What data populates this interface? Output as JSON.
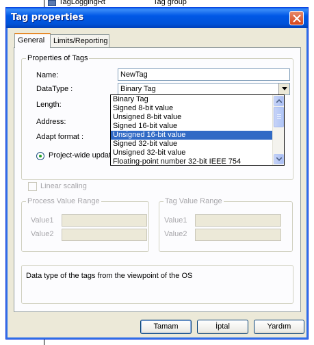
{
  "background": {
    "col1": "TagLoggingRt",
    "col2": "Tag group"
  },
  "window": {
    "title": "Tag properties"
  },
  "tabs": [
    {
      "label": "General",
      "active": true
    },
    {
      "label": "Limits/Reporting",
      "active": false
    }
  ],
  "properties_group": {
    "legend": "Properties of Tags",
    "name_label": "Name:",
    "name_value": "NewTag",
    "datatype_label": "DataType :",
    "datatype_value": "Binary Tag",
    "length_label": "Length:",
    "address_label": "Address:",
    "adapt_label": "Adapt format :",
    "radio_label": "Project-wide update",
    "radio_checked": true
  },
  "datatype_options": [
    {
      "label": "Binary Tag",
      "selected": false
    },
    {
      "label": "Signed 8-bit value",
      "selected": false
    },
    {
      "label": "Unsigned 8-bit value",
      "selected": false
    },
    {
      "label": "Signed 16-bit value",
      "selected": false
    },
    {
      "label": "Unsigned 16-bit value",
      "selected": true
    },
    {
      "label": "Signed 32-bit value",
      "selected": false
    },
    {
      "label": "Unsigned 32-bit value",
      "selected": false
    },
    {
      "label": "Floating-point number 32-bit IEEE 754",
      "selected": false
    }
  ],
  "linear_scaling": {
    "label": "Linear scaling",
    "enabled": false
  },
  "process_range": {
    "legend": "Process Value Range",
    "value1_label": "Value1",
    "value2_label": "Value2"
  },
  "tag_range": {
    "legend": "Tag Value Range",
    "value1_label": "Value1",
    "value2_label": "Value2"
  },
  "description": "Data type of the tags from the viewpoint of the OS",
  "buttons": {
    "ok": "Tamam",
    "cancel": "İptal",
    "help": "Yardım"
  },
  "colors": {
    "title_bar": "#0058e6",
    "selection": "#316ac5",
    "dialog_face": "#ece9d8"
  }
}
